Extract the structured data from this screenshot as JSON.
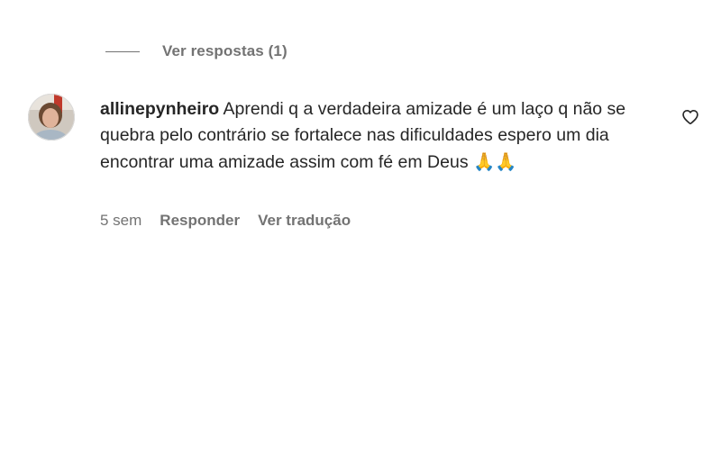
{
  "view_replies": {
    "label": "Ver respostas (1)"
  },
  "comment": {
    "username": "allinepynheiro",
    "text": "Aprendi q a verdadeira amizade é um laço q não se quebra pelo contrário se fortalece nas dificuldades espero um dia encontrar uma amizade assim com fé em Deus",
    "emoji": "🙏🙏",
    "time": "5 sem",
    "reply_label": "Responder",
    "translate_label": "Ver tradução",
    "avatar_icon": "user-avatar-photo",
    "like_icon": "heart-outline-icon"
  },
  "colors": {
    "text_primary": "#262626",
    "text_secondary": "#737373",
    "background": "#ffffff"
  }
}
